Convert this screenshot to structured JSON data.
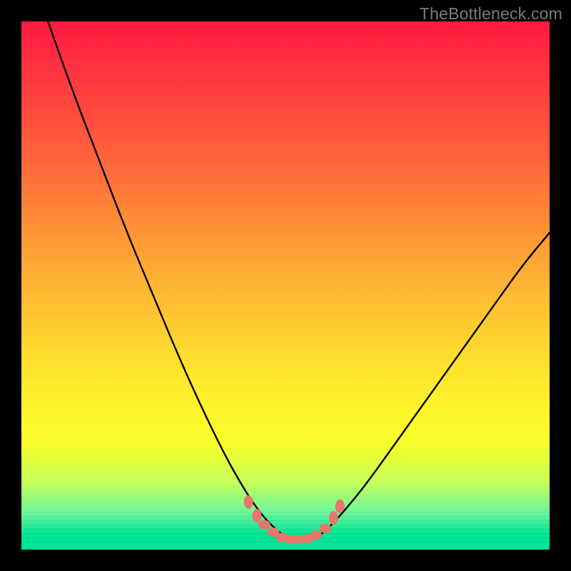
{
  "watermark": "TheBottleneck.com",
  "chart_data": {
    "type": "line",
    "title": "",
    "xlabel": "",
    "ylabel": "",
    "xlim": [
      0,
      100
    ],
    "ylim": [
      0,
      100
    ],
    "grid": false,
    "background_gradient": {
      "top": "#ff1a41",
      "mid": "#ffe12e",
      "bottom": "#00e498"
    },
    "series": [
      {
        "name": "bottleneck-curve",
        "color": "#000000",
        "x": [
          0,
          5,
          10,
          15,
          20,
          25,
          30,
          35,
          40,
          45,
          49,
          51,
          55,
          57,
          60,
          65,
          70,
          75,
          80,
          85,
          90,
          95,
          100
        ],
        "y": [
          115,
          100,
          86,
          73,
          60,
          48,
          36,
          25,
          15,
          7,
          3,
          2,
          2,
          3,
          6,
          12,
          19,
          26,
          33,
          40,
          47,
          54,
          60
        ]
      }
    ],
    "markers": {
      "name": "valley-points",
      "color": "#e9756b",
      "x": [
        43.0,
        44.6,
        46.0,
        47.7,
        49.3,
        51.0,
        52.5,
        54.2,
        55.7,
        57.5,
        59.1,
        60.3
      ],
      "y": [
        9.0,
        6.4,
        4.7,
        3.3,
        2.3,
        1.9,
        1.9,
        2.1,
        2.7,
        4.0,
        6.0,
        8.2
      ]
    }
  }
}
